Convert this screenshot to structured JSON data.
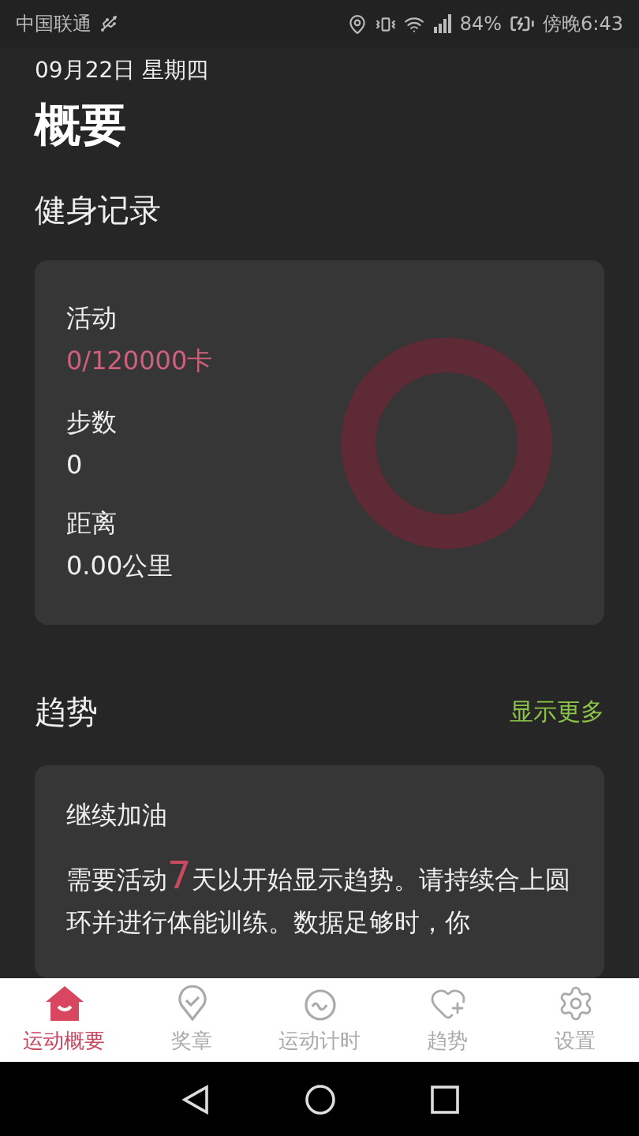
{
  "status_bar": {
    "carrier": "中国联通",
    "battery": "84%",
    "time": "傍晚6:43"
  },
  "date": "09月22日 星期四",
  "title": "概要",
  "fitness": {
    "heading": "健身记录",
    "stats": [
      {
        "label": "活动",
        "value": "0/120000卡",
        "kind": "highlight"
      },
      {
        "label": "步数",
        "value": "0",
        "kind": "plain"
      },
      {
        "label": "距离",
        "value": "0.00公里",
        "kind": "plain"
      }
    ]
  },
  "trends": {
    "heading": "趋势",
    "more": "显示更多",
    "card": {
      "title": "继续加油",
      "before": "需要活动",
      "highlight": "7",
      "after": "天以开始显示趋势。请持续合上圆环并进行体能训练。数据足够时，你"
    }
  },
  "tabs": [
    {
      "label": "运动概要",
      "kind": "home",
      "selected": true
    },
    {
      "label": "奖章",
      "kind": "medal",
      "selected": false
    },
    {
      "label": "运动计时",
      "kind": "timer",
      "selected": false
    },
    {
      "label": "趋势",
      "kind": "heart",
      "selected": false
    },
    {
      "label": "设置",
      "kind": "gear",
      "selected": false
    }
  ]
}
